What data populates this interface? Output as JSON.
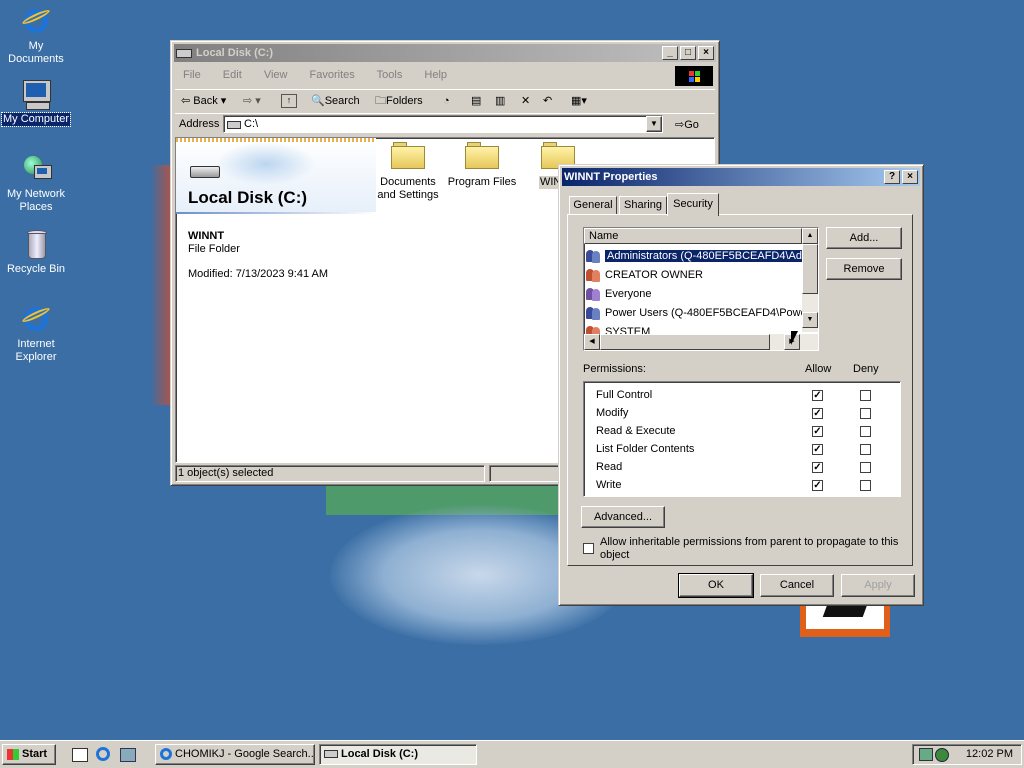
{
  "desktop": {
    "icons": [
      {
        "label": "My Documents"
      },
      {
        "label": "My Computer"
      },
      {
        "label": "My Network Places"
      },
      {
        "label": "Recycle Bin"
      },
      {
        "label": "Internet Explorer"
      }
    ]
  },
  "explorer": {
    "title": "Local Disk (C:)",
    "menu": [
      "File",
      "Edit",
      "View",
      "Favorites",
      "Tools",
      "Help"
    ],
    "toolbar": {
      "back": "Back",
      "search": "Search",
      "folders": "Folders"
    },
    "address_label": "Address",
    "address_value": "C:\\",
    "go_label": "Go",
    "panel_title": "Local Disk (C:)",
    "selected_name": "WINNT",
    "selected_type": "File Folder",
    "modified": "Modified: 7/13/2023 9:41 AM",
    "folders": [
      "Documents and Settings",
      "Program Files",
      "WINNT"
    ],
    "status": "1 object(s) selected"
  },
  "dialog": {
    "title": "WINNT Properties",
    "tabs": [
      "General",
      "Sharing",
      "Security"
    ],
    "name_header": "Name",
    "users": [
      "Administrators (Q-480EF5BCEAFD4\\Admi",
      "CREATOR OWNER",
      "Everyone",
      "Power Users (Q-480EF5BCEAFD4\\Powe",
      "SYSTEM"
    ],
    "add_label": "Add...",
    "remove_label": "Remove",
    "permissions_label": "Permissions:",
    "allow_label": "Allow",
    "deny_label": "Deny",
    "permissions": [
      {
        "name": "Full Control",
        "allow": true,
        "deny": false
      },
      {
        "name": "Modify",
        "allow": true,
        "deny": false
      },
      {
        "name": "Read & Execute",
        "allow": true,
        "deny": false
      },
      {
        "name": "List Folder Contents",
        "allow": true,
        "deny": false
      },
      {
        "name": "Read",
        "allow": true,
        "deny": false
      },
      {
        "name": "Write",
        "allow": true,
        "deny": false
      }
    ],
    "advanced_label": "Advanced...",
    "inherit_label": "Allow inheritable permissions from parent to propagate to this object",
    "ok_label": "OK",
    "cancel_label": "Cancel",
    "apply_label": "Apply"
  },
  "taskbar": {
    "start_label": "Start",
    "tasks": [
      "CHOMIKJ - Google Search...",
      "Local Disk (C:)"
    ],
    "clock": "12:02 PM"
  },
  "colors": {
    "desktop": "#3a6ea5",
    "title_active": "#0a246a",
    "selection": "#0a246a"
  }
}
